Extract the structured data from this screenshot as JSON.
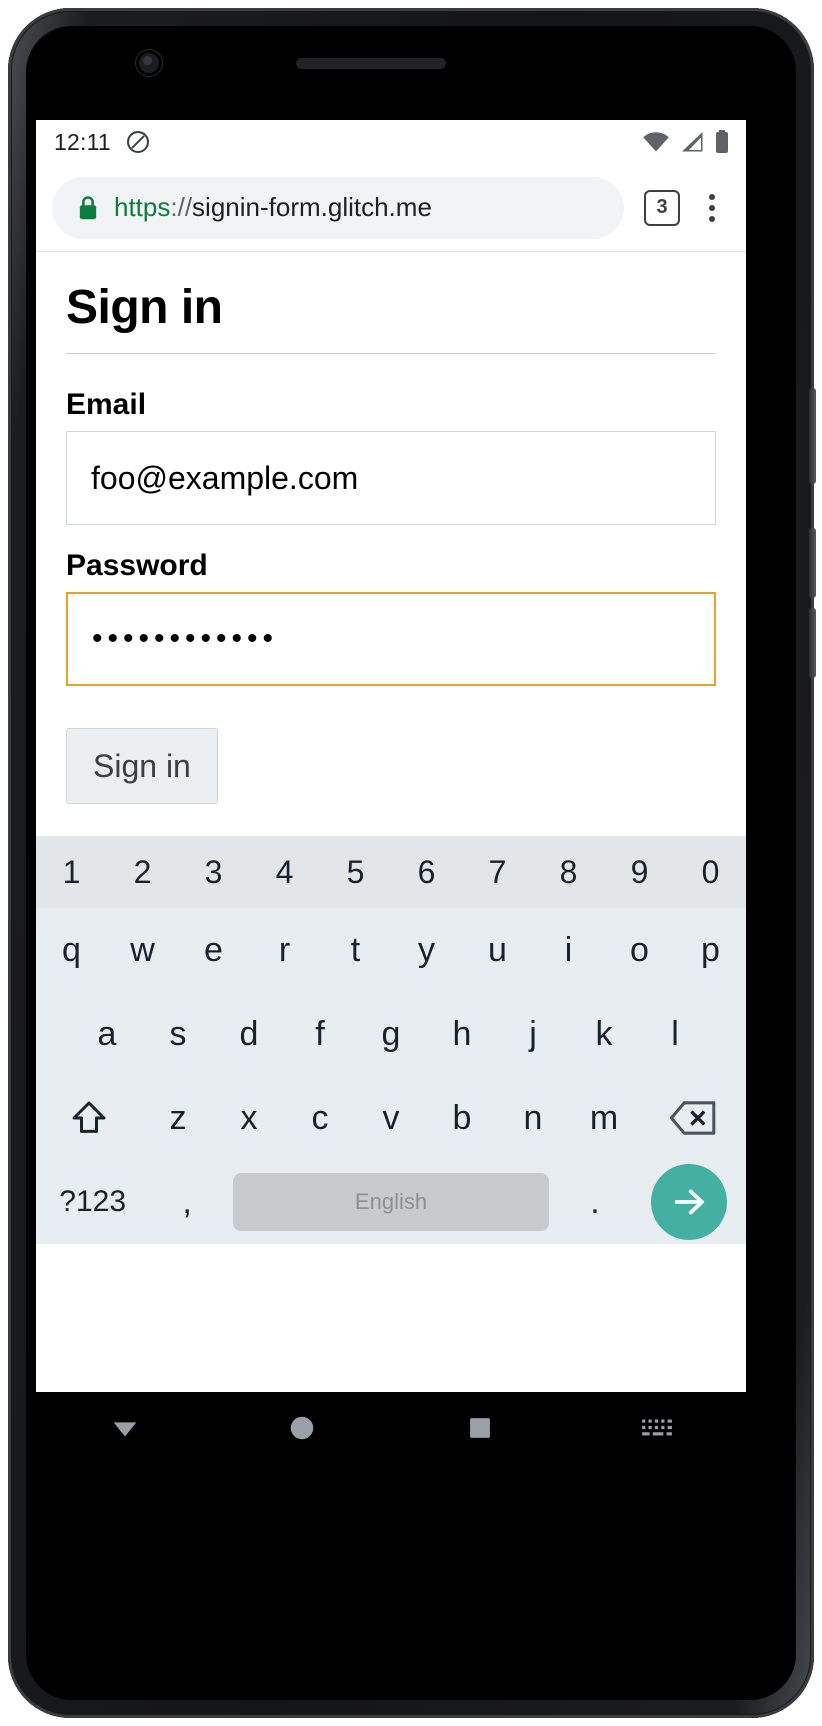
{
  "device": {
    "camera_icon": "front-camera",
    "earpiece_icon": "earpiece-speaker"
  },
  "status_bar": {
    "time": "12:11",
    "icons": [
      "do-not-disturb-icon",
      "wifi-icon",
      "cell-signal-icon",
      "battery-icon"
    ]
  },
  "browser": {
    "lock_icon": "lock-icon",
    "url_scheme": "https",
    "url_separator": "://",
    "url_host": "signin-form.glitch.me",
    "full_url": "https://signin-form.glitch.me",
    "tab_count": "3",
    "menu_icon": "overflow-menu-icon"
  },
  "page": {
    "title": "Sign in",
    "email": {
      "label": "Email",
      "value": "foo@example.com",
      "placeholder": ""
    },
    "password": {
      "label": "Password",
      "value": "••••••••••••",
      "masked_length": 12,
      "focused": true,
      "focus_color": "#e8a22a"
    },
    "submit_label": "Sign in"
  },
  "keyboard": {
    "number_row": [
      "1",
      "2",
      "3",
      "4",
      "5",
      "6",
      "7",
      "8",
      "9",
      "0"
    ],
    "row1": [
      "q",
      "w",
      "e",
      "r",
      "t",
      "y",
      "u",
      "i",
      "o",
      "p"
    ],
    "row2": [
      "a",
      "s",
      "d",
      "f",
      "g",
      "h",
      "j",
      "k",
      "l"
    ],
    "row3": [
      "z",
      "x",
      "c",
      "v",
      "b",
      "n",
      "m"
    ],
    "shift_icon": "shift-icon",
    "backspace_icon": "backspace-icon",
    "symbols_label": "?123",
    "comma_label": ",",
    "spacebar_label": "English",
    "period_label": ".",
    "enter_icon": "arrow-right-icon",
    "enter_color": "#44b0a1"
  },
  "nav_bar": {
    "back_icon": "back-triangle-icon",
    "home_icon": "home-circle-icon",
    "recents_icon": "recents-square-icon",
    "keyboard_icon": "keyboard-icon"
  }
}
